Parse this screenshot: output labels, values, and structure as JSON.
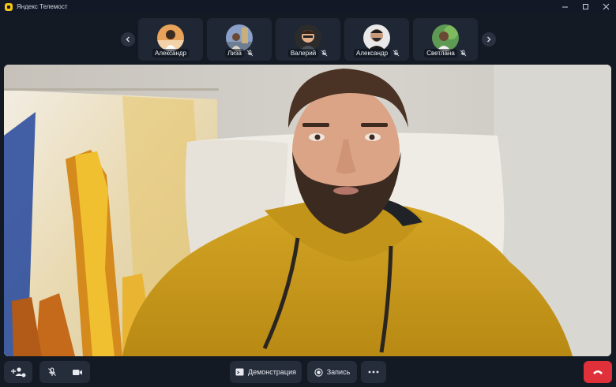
{
  "window": {
    "title": "Яндекс Телемост",
    "controls": [
      "minimize",
      "maximize",
      "close"
    ]
  },
  "strip": {
    "prev_icon": "chevron-left-icon",
    "next_icon": "chevron-right-icon",
    "participants": [
      {
        "name": "Александр",
        "muted": false,
        "avatar_color": "#e8a35a"
      },
      {
        "name": "Лиза",
        "muted": true,
        "avatar_color": "#8aa0c8"
      },
      {
        "name": "Валерий",
        "muted": true,
        "avatar_color": "#2b2b2b"
      },
      {
        "name": "Александр",
        "muted": true,
        "avatar_color": "#3a3a3a"
      },
      {
        "name": "Светлана",
        "muted": true,
        "avatar_color": "#5f9a55"
      }
    ]
  },
  "toolbar": {
    "invite_icon": "add-user-icon",
    "mic_icon": "mic-off-icon",
    "camera_icon": "camera-icon",
    "screen_share_label": "Демонстрация",
    "record_label": "Запись",
    "more_icon": "more-dots-icon",
    "hangup_icon": "hangup-icon"
  },
  "colors": {
    "background": "#141a24",
    "tile": "#1f2634",
    "button": "#252c3a",
    "hangup": "#e0313a",
    "hoodie": "#c99a1c"
  }
}
